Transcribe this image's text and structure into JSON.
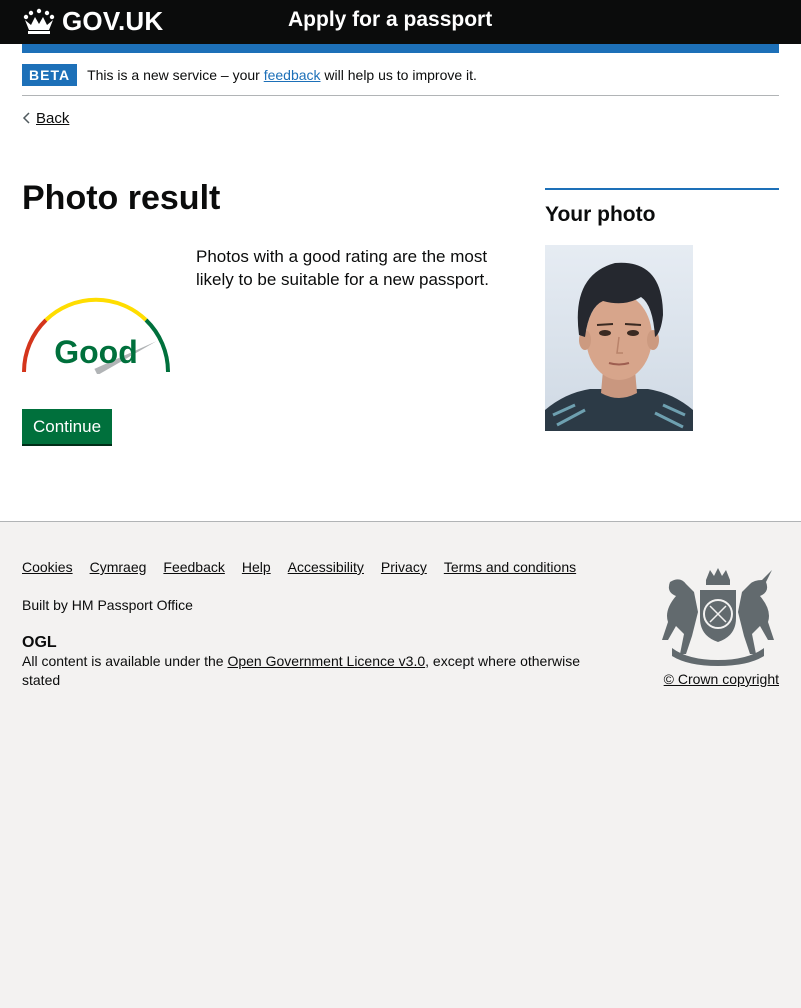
{
  "header": {
    "logo_text": "GOV.UK",
    "service_name": "Apply for a passport"
  },
  "beta": {
    "tag": "BETA",
    "text_before": "This is a new service – your ",
    "link": "feedback",
    "text_after": " will help us to improve it."
  },
  "back_link": "Back",
  "main": {
    "title": "Photo result",
    "rating": "Good",
    "rating_fraction": 0.85,
    "description": "Photos with a good rating are the most likely to be suitable for a new passport.",
    "continue_label": "Continue"
  },
  "aside": {
    "title": "Your photo"
  },
  "footer": {
    "links": [
      "Cookies",
      "Cymraeg",
      "Feedback",
      "Help",
      "Accessibility",
      "Privacy",
      "Terms and conditions"
    ],
    "built_by": "Built by HM Passport Office",
    "ogl": "OGL",
    "licence_before": "All content is available under the ",
    "licence_link": "Open Government Licence v3.0",
    "licence_after": ", except where otherwise stated",
    "copyright": "© Crown copyright"
  },
  "colors": {
    "header_bg": "#0b0c0c",
    "brand_blue": "#1d70b8",
    "button_green": "#00703c",
    "gauge_red": "#d4351c",
    "gauge_yellow": "#ffdd00",
    "gauge_green": "#00703c",
    "footer_bg": "#f3f2f1"
  },
  "icons": {
    "logo": "crown-icon",
    "back": "chevron-left-icon",
    "crest": "royal-coat-of-arms-icon"
  }
}
